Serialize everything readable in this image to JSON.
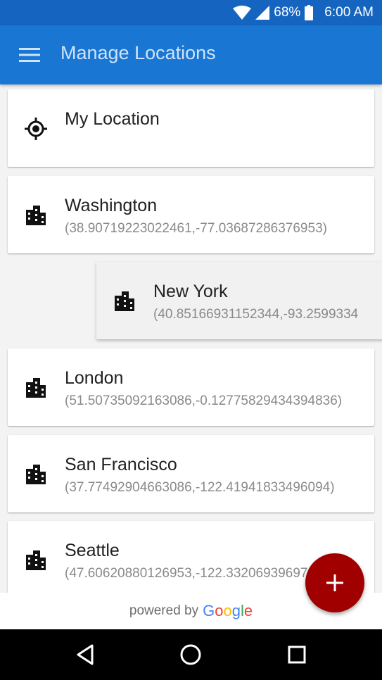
{
  "status_bar": {
    "battery": "68%",
    "time": "6:00 AM"
  },
  "app_bar": {
    "title": "Manage Locations",
    "menu_icon": "hamburger-menu-icon"
  },
  "locations": [
    {
      "name": "My Location",
      "coords": "",
      "icon": "my-location-icon"
    },
    {
      "name": "Washington",
      "coords": "(38.90719223022461,-77.03687286376953)",
      "icon": "city-icon"
    },
    {
      "name": "New York",
      "coords": "(40.85166931152344,-93.2599334",
      "icon": "city-icon"
    },
    {
      "name": "London",
      "coords": "(51.50735092163086,-0.12775829434394836)",
      "icon": "city-icon"
    },
    {
      "name": "San Francisco",
      "coords": "(37.77492904663086,-122.41941833496094)",
      "icon": "city-icon"
    },
    {
      "name": "Seattle",
      "coords": "(47.60620880126953,-122.3320693969726",
      "icon": "city-icon"
    }
  ],
  "footer": {
    "powered_by": "powered by",
    "brand": "Google"
  },
  "fab": {
    "icon": "plus-icon"
  },
  "nav": {
    "back_icon": "back-triangle-icon",
    "home_icon": "home-circle-icon",
    "recents_icon": "recents-square-icon"
  },
  "colors": {
    "status_bar": "#1565c0",
    "app_bar": "#1976d2",
    "fab": "#a00000"
  }
}
